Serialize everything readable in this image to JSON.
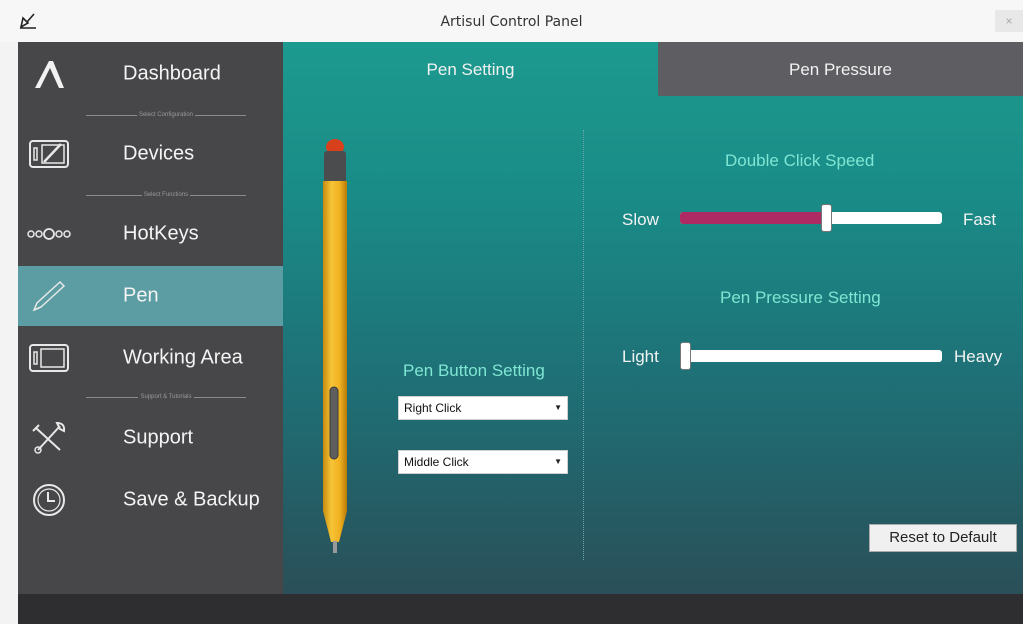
{
  "window": {
    "title": "Artisul Control Panel",
    "close_glyph": "×"
  },
  "sidebar": {
    "items": [
      {
        "label": "Dashboard",
        "icon": "artisul-logo-icon"
      },
      {
        "label": "Devices",
        "icon": "tablet-icon"
      },
      {
        "label": "HotKeys",
        "icon": "hotkeys-icon"
      },
      {
        "label": "Pen",
        "icon": "pen-icon",
        "active": true
      },
      {
        "label": "Working Area",
        "icon": "working-area-icon"
      },
      {
        "label": "Support",
        "icon": "tools-icon"
      },
      {
        "label": "Save & Backup",
        "icon": "clock-icon"
      }
    ],
    "separators": [
      "Select Configuration",
      "Select Functions",
      "Support & Tutorials"
    ]
  },
  "tabs": {
    "pen_setting": "Pen Setting",
    "pen_pressure": "Pen Pressure"
  },
  "pen_button_setting": {
    "title": "Pen Button Setting",
    "upper_button": "Right Click",
    "lower_button": "Middle Click",
    "arrow_glyph": "▼"
  },
  "double_click_speed": {
    "title": "Double Click Speed",
    "min_label": "Slow",
    "max_label": "Fast",
    "value_fraction": 0.56
  },
  "pen_pressure_setting": {
    "title": "Pen Pressure Setting",
    "min_label": "Light",
    "max_label": "Heavy",
    "value_fraction": 0.0
  },
  "reset_button": "Reset to Default",
  "colors": {
    "accent": "#ad2a63",
    "title_teal": "#7fe6d3",
    "sidebar_active": "#5b9da2",
    "sidebar_bg": "#474749"
  }
}
